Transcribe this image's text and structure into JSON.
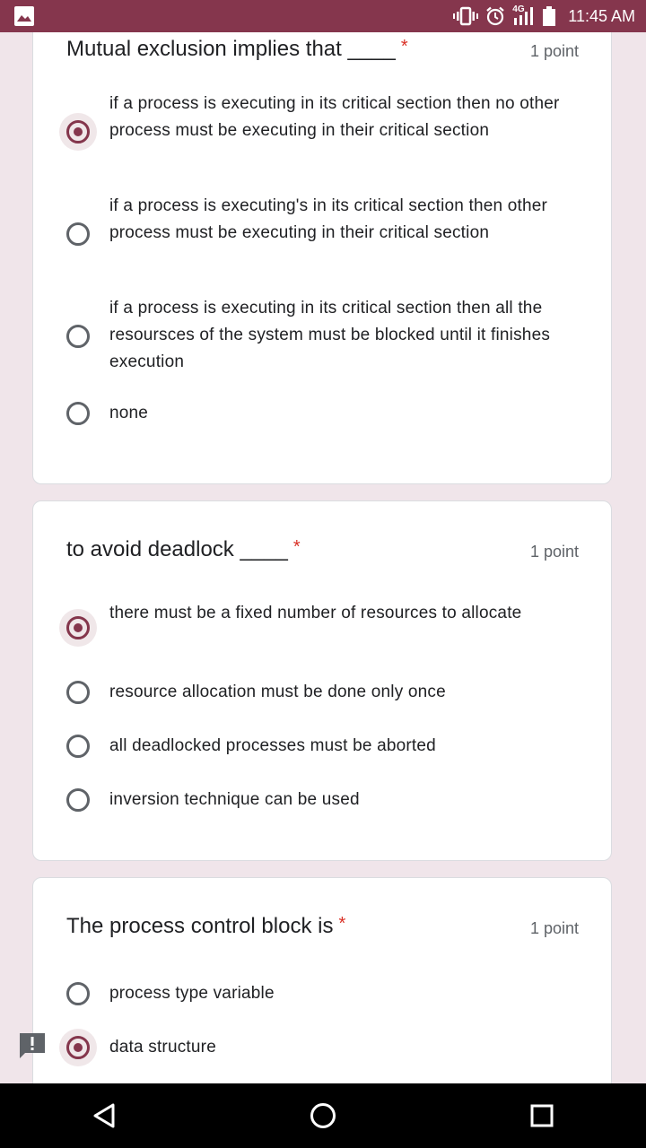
{
  "status_bar": {
    "network": "4G",
    "time": "11:45 AM"
  },
  "questions": [
    {
      "title": "Mutual exclusion implies that ____",
      "required_mark": "*",
      "points": "1 point",
      "options": [
        {
          "label": "if a process is executing in its critical section then no other process must be executing in their critical section",
          "selected": true
        },
        {
          "label": "if a process is executing's in its critical section then other process must be executing in their critical section",
          "selected": false
        },
        {
          "label": "if a process is executing in its critical section then all the resoursces of the system must be blocked until it finishes execution",
          "selected": false
        },
        {
          "label": "none",
          "selected": false
        }
      ]
    },
    {
      "title": "to avoid deadlock ____",
      "required_mark": "*",
      "points": "1 point",
      "options": [
        {
          "label": "there must be a fixed number of resources to allocate",
          "selected": true
        },
        {
          "label": "resource allocation must be done only once",
          "selected": false
        },
        {
          "label": "all deadlocked processes must be aborted",
          "selected": false
        },
        {
          "label": "inversion technique can be used",
          "selected": false
        }
      ]
    },
    {
      "title": "The process control block is",
      "required_mark": "*",
      "points": "1 point",
      "options": [
        {
          "label": "process type variable",
          "selected": false
        },
        {
          "label": "data structure",
          "selected": true
        }
      ]
    }
  ],
  "colors": {
    "accent": "#85364d",
    "background": "#f0e5ea",
    "required": "#d93025"
  },
  "icons": {
    "status_left": "gallery-icon",
    "status_right": [
      "vibrate-icon",
      "alarm-icon",
      "signal-icon",
      "battery-icon"
    ],
    "feedback": "feedback-icon",
    "nav": [
      "back-icon",
      "home-icon",
      "recents-icon"
    ]
  }
}
